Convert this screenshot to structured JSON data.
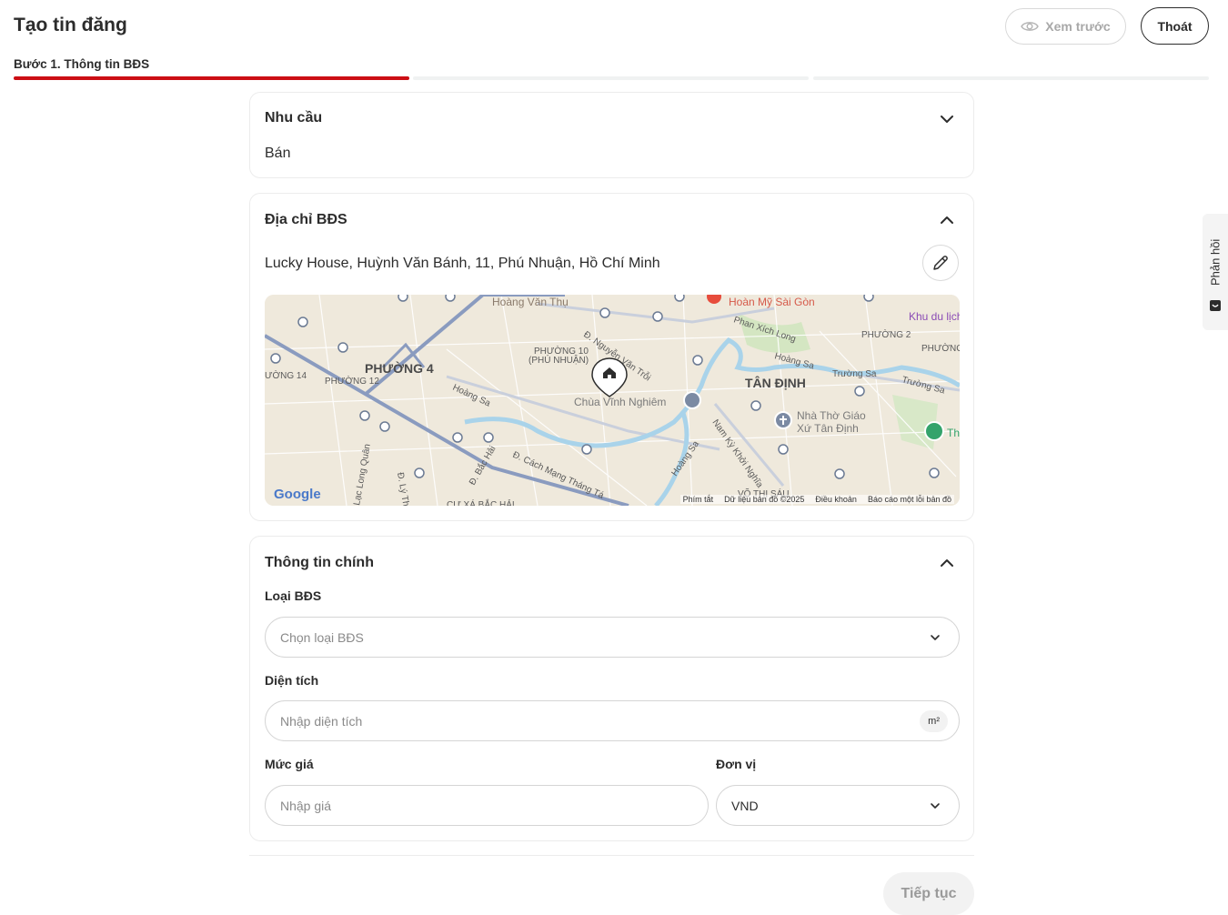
{
  "header": {
    "title": "Tạo tin đăng",
    "preview_label": "Xem trước",
    "exit_label": "Thoát",
    "step_label": "Bước 1. Thông tin BĐS",
    "step_progress": 1.0,
    "total_steps": 3
  },
  "need": {
    "title": "Nhu cầu",
    "value": "Bán"
  },
  "address": {
    "title": "Địa chỉ BĐS",
    "value": "Lucky House, Huỳnh Văn Bánh, 11, Phú Nhuận, Hồ Chí Minh",
    "map": {
      "labels": {
        "hoang_van_thu": "Hoàng Văn Thụ",
        "hoan_my": "Hoàn Mỹ Sài Gòn",
        "khu_du_lich": "Khu du lịch",
        "phan_xich_long": "Phan Xích Long",
        "phuong_2": "PHƯỜNG 2",
        "phuong": "PHƯỜNG",
        "phuong_10": "PHƯỜNG 10",
        "phu_nhuan": "(PHÚ NHUẬN)",
        "nguyen_van_troi": "Đ. Nguyễn Văn Trỗi",
        "hoang_sa_1": "Hoàng Sa",
        "truong_sa_1": "Trường Sa",
        "truong_sa_2": "Trường Sa",
        "tan_dinh": "TÂN ĐỊNH",
        "phuong_4": "PHƯỜNG 4",
        "phuong_12": "PHƯỜNG 12",
        "phuong_14": "ƯỜNG 14",
        "hoang_sa_2": "Hoàng Sa",
        "chua_vinh_nghiem": "Chùa Vĩnh Nghiêm",
        "nha_tho_1": "Nhà Thờ Giáo",
        "nha_tho_2": "Xứ Tân Định",
        "nam_ky": "Nam Kỳ Khởi Nghĩa",
        "hoang_sa_3": "Hoàng Sa",
        "cach_mang": "Đ. Cách Mạng Tháng Tá",
        "bac_hai": "Đ. Bắc Hải",
        "lac_long_quan": "Lạc Long Quân",
        "ly_thuong_kiet": "Đ. Lý Th",
        "cu_xa": "CƯ XÁ BẮC HẢI",
        "vo_thi_sau": "VÕ THỊ SÁU",
        "th": "Th",
        "google": "Google"
      },
      "footer": {
        "shortcuts": "Phím tắt",
        "data": "Dữ liệu bản đồ ©2025",
        "terms": "Điều khoản",
        "report": "Báo cáo một lỗi bản đồ"
      }
    }
  },
  "main_info": {
    "title": "Thông tin chính",
    "type_label": "Loại BĐS",
    "type_placeholder": "Chọn loại BĐS",
    "area_label": "Diện tích",
    "area_placeholder": "Nhập diện tích",
    "area_unit": "m²",
    "price_label": "Mức giá",
    "price_placeholder": "Nhập giá",
    "unit_label": "Đơn vị",
    "unit_value": "VND"
  },
  "footer": {
    "next_label": "Tiếp tục"
  },
  "feedback": {
    "label": "Phản hồi"
  },
  "colors": {
    "accent": "#cc0e14",
    "text": "#2c2c2c",
    "muted": "#8a8a8a",
    "border": "#d5d5d5"
  }
}
